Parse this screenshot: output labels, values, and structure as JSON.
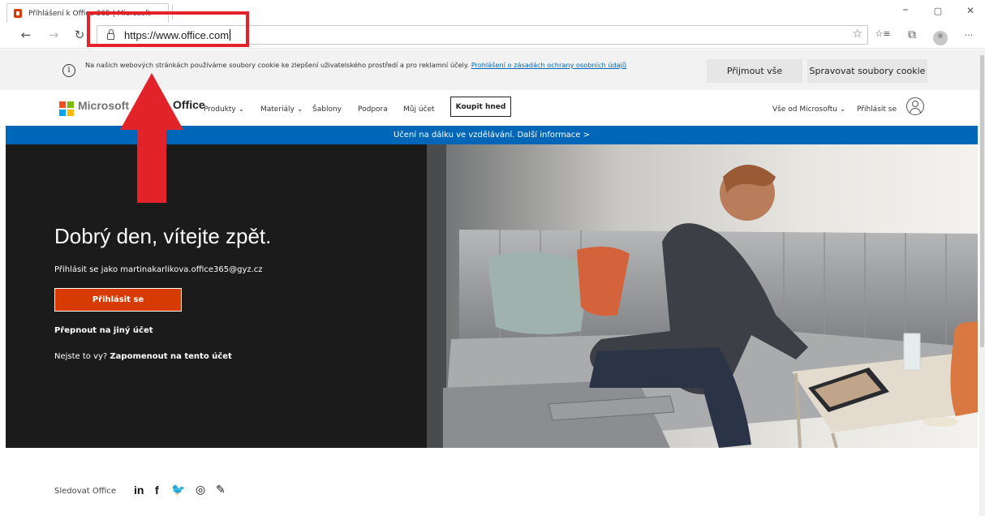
{
  "browser": {
    "tab_title": "Přihlášení k Office 365 | Microsoft",
    "url": "https://www.office.com",
    "window_controls": {
      "minimize": "–",
      "maximize": "▢",
      "close": "✕"
    },
    "nav": {
      "back": "←",
      "forward": "→",
      "refresh": "↻"
    },
    "toolbar": {
      "favorite": "☆",
      "favorites_list": "☆≡",
      "collections": "⧉",
      "more": "···"
    }
  },
  "cookie_banner": {
    "text": "Na našich webových stránkách používáme soubory cookie ke zlepšení uživatelského prostředí a pro reklamní účely.",
    "link": "Prohlášení o zásadách ochrany osobních údajů",
    "accept_label": "Přijmout vše",
    "manage_label": "Spravovat soubory cookie"
  },
  "header": {
    "brand": "Microsoft",
    "product": "Office",
    "nav": [
      "Produkty ⌄",
      "Materiály ⌄",
      "Šablony",
      "Podpora",
      "Můj účet"
    ],
    "buy_label": "Koupit hned",
    "all_microsoft": "Vše od Microsoftu ⌄",
    "signin_link": "Přihlásit se"
  },
  "banner": {
    "text": "Učení na dálku ve vzdělávání. Další informace >"
  },
  "hero": {
    "title": "Dobrý den, vítejte zpět.",
    "signed_as": "Přihlásit se jako martinakarlikova.office365@gyz.cz",
    "signin_button": "Přihlásit se",
    "switch_account": "Přepnout na jiný účet",
    "not_you": "Nejste to vy?",
    "forget_account": "Zapomenout na tento účet"
  },
  "footer": {
    "follow_label": "Sledovat Office",
    "social": [
      "in",
      "f",
      "🐦",
      "◎",
      "✎"
    ]
  },
  "colors": {
    "accent_orange": "#d83b01",
    "link_blue": "#0067b8",
    "annotation_red": "#e2242a"
  }
}
